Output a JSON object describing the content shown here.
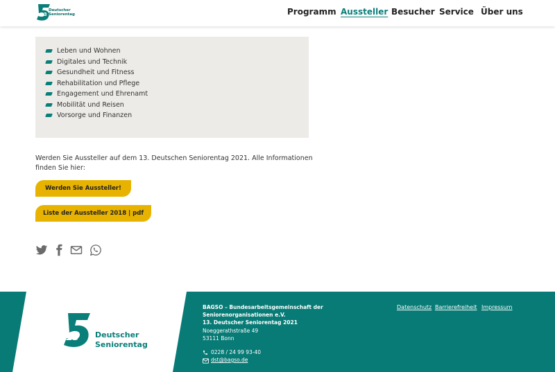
{
  "header": {
    "logo_line1": "Deutscher",
    "logo_line2": "Seniorentag",
    "nav": [
      "Programm",
      "Aussteller",
      "Besucher",
      "Service",
      "Über uns"
    ]
  },
  "topics": [
    "Leben und Wohnen",
    "Digitales und Technik",
    "Gesundheit und Fitness",
    "Rehabilitation und Pflege",
    "Engagement und Ehrenamt",
    "Mobilität und Reisen",
    "Vorsorge und Finanzen"
  ],
  "intro_text": "Werden Sie Aussteller auf dem 13. Deutschen Seniorentag 2021. Alle Informationen finden Sie hier:",
  "buttons": {
    "become_exhibitor": "Werden Sie Aussteller!",
    "exhibitor_list": "Liste der Aussteller 2018 | pdf"
  },
  "share_icons": [
    "twitter-icon",
    "facebook-icon",
    "mail-icon",
    "whatsapp-icon"
  ],
  "footer": {
    "logo_line1": "Deutscher",
    "logo_line2": "Seniorentag",
    "org_line1": "BAGSO – Bundesarbeitsgemeinschaft der",
    "org_line2": "Seniorenorganisationen e.V.",
    "event": "13. Deutscher Seniorentag 2021",
    "street": "Noeggerathstraße 49",
    "city": "53111 Bonn",
    "phone": "0228 / 24 99 93-40",
    "email": "dst@bagso.de",
    "links": [
      "Datenschutz",
      "Barrierefreiheit",
      "Impressum"
    ]
  },
  "colors": {
    "teal": "#087b76",
    "yellow": "#e8b300",
    "box_grey": "#ecebe7"
  }
}
